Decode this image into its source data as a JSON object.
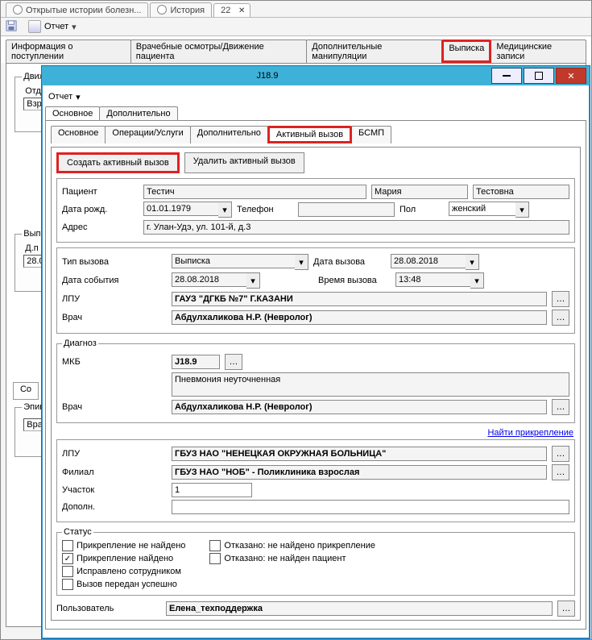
{
  "top_tabs": {
    "t0": "Открытые истории болезн...",
    "t1": "История",
    "t2": "22"
  },
  "toolbar": {
    "report": "Отчет"
  },
  "main_tabs": {
    "t0": "Информация о поступлении",
    "t1": "Врачебные осмотры/Движение пациента",
    "t2": "Дополнительные манипуляции",
    "t3": "Выписка",
    "t4": "Медицинские записи"
  },
  "bg": {
    "group1": "Движ",
    "otd": "Отд",
    "vzr": "Взр",
    "group2": "Выпи",
    "dp": "Д.п",
    "date": "28.0",
    "co": "Со",
    "epik": "Эпик",
    "vra": "Вра"
  },
  "modal": {
    "title": "J18.9",
    "toolbar_report": "Отчет",
    "inner_tabs": {
      "main": "Основное",
      "extra": "Дополнительно"
    },
    "sub_tabs": {
      "t0": "Основное",
      "t1": "Операции/Услуги",
      "t2": "Дополнительно",
      "t3": "Активный вызов",
      "t4": "БСМП"
    },
    "actions": {
      "create": "Создать активный вызов",
      "delete": "Удалить активный вызов"
    },
    "patient": {
      "label": "Пациент",
      "surname": "Тестич",
      "name": "Мария",
      "patronymic": "Тестовна",
      "dob_label": "Дата рожд.",
      "dob": "01.01.1979",
      "phone_label": "Телефон",
      "phone": "",
      "sex_label": "Пол",
      "sex": "женский",
      "addr_label": "Адрес",
      "addr": "г. Улан-Удэ, ул. 101-й, д.3"
    },
    "call": {
      "type_label": "Тип вызова",
      "type": "Выписка",
      "date_call_label": "Дата вызова",
      "date_call": "28.08.2018",
      "date_event_label": "Дата события",
      "date_event": "28.08.2018",
      "time_call_label": "Время вызова",
      "time_call": "13:48",
      "lpu_label": "ЛПУ",
      "lpu": "ГАУЗ \"ДГКБ №7\" Г.КАЗАНИ",
      "doctor_label": "Врач",
      "doctor": "Абдулхаликова Н.Р. (Невролог)"
    },
    "diag": {
      "legend": "Диагноз",
      "mkb_label": "МКБ",
      "mkb": "J18.9",
      "desc": "Пневмония неуточненная",
      "doctor_label": "Врач",
      "doctor": "Абдулхаликова Н.Р. (Невролог)"
    },
    "link_find": "Найти прикрепление",
    "attach": {
      "lpu_label": "ЛПУ",
      "lpu": "ГБУЗ НАО \"НЕНЕЦКАЯ ОКРУЖНАЯ БОЛЬНИЦА\"",
      "filial_label": "Филиал",
      "filial": "ГБУЗ НАО \"НОБ\" - Поликлиника взрослая",
      "uch_label": "Участок",
      "uch": "1",
      "dop_label": "Дополн."
    },
    "status": {
      "legend": "Статус",
      "s1": "Прикрепление не найдено",
      "s2": "Прикрепление найдено",
      "s3": "Исправлено сотрудником",
      "s4": "Вызов передан успешно",
      "s5": "Отказано: не найдено прикрепление",
      "s6": "Отказано: не найден пациент"
    },
    "user": {
      "label": "Пользователь",
      "value": "Елена_техподдержка"
    }
  }
}
